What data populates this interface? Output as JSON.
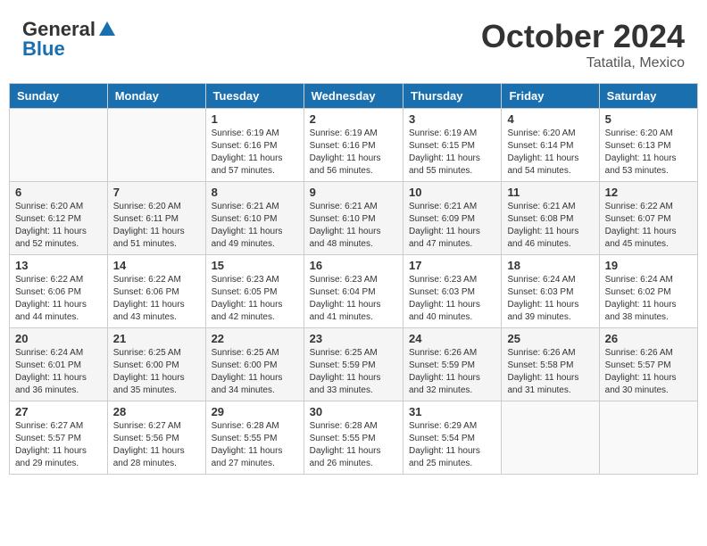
{
  "header": {
    "logo_line1": "General",
    "logo_line2": "Blue",
    "month": "October 2024",
    "location": "Tatatila, Mexico"
  },
  "days_of_week": [
    "Sunday",
    "Monday",
    "Tuesday",
    "Wednesday",
    "Thursday",
    "Friday",
    "Saturday"
  ],
  "weeks": [
    [
      {
        "day": "",
        "sunrise": "",
        "sunset": "",
        "daylight": "",
        "empty": true
      },
      {
        "day": "",
        "sunrise": "",
        "sunset": "",
        "daylight": "",
        "empty": true
      },
      {
        "day": "1",
        "sunrise": "Sunrise: 6:19 AM",
        "sunset": "Sunset: 6:16 PM",
        "daylight": "Daylight: 11 hours and 57 minutes."
      },
      {
        "day": "2",
        "sunrise": "Sunrise: 6:19 AM",
        "sunset": "Sunset: 6:16 PM",
        "daylight": "Daylight: 11 hours and 56 minutes."
      },
      {
        "day": "3",
        "sunrise": "Sunrise: 6:19 AM",
        "sunset": "Sunset: 6:15 PM",
        "daylight": "Daylight: 11 hours and 55 minutes."
      },
      {
        "day": "4",
        "sunrise": "Sunrise: 6:20 AM",
        "sunset": "Sunset: 6:14 PM",
        "daylight": "Daylight: 11 hours and 54 minutes."
      },
      {
        "day": "5",
        "sunrise": "Sunrise: 6:20 AM",
        "sunset": "Sunset: 6:13 PM",
        "daylight": "Daylight: 11 hours and 53 minutes."
      }
    ],
    [
      {
        "day": "6",
        "sunrise": "Sunrise: 6:20 AM",
        "sunset": "Sunset: 6:12 PM",
        "daylight": "Daylight: 11 hours and 52 minutes."
      },
      {
        "day": "7",
        "sunrise": "Sunrise: 6:20 AM",
        "sunset": "Sunset: 6:11 PM",
        "daylight": "Daylight: 11 hours and 51 minutes."
      },
      {
        "day": "8",
        "sunrise": "Sunrise: 6:21 AM",
        "sunset": "Sunset: 6:10 PM",
        "daylight": "Daylight: 11 hours and 49 minutes."
      },
      {
        "day": "9",
        "sunrise": "Sunrise: 6:21 AM",
        "sunset": "Sunset: 6:10 PM",
        "daylight": "Daylight: 11 hours and 48 minutes."
      },
      {
        "day": "10",
        "sunrise": "Sunrise: 6:21 AM",
        "sunset": "Sunset: 6:09 PM",
        "daylight": "Daylight: 11 hours and 47 minutes."
      },
      {
        "day": "11",
        "sunrise": "Sunrise: 6:21 AM",
        "sunset": "Sunset: 6:08 PM",
        "daylight": "Daylight: 11 hours and 46 minutes."
      },
      {
        "day": "12",
        "sunrise": "Sunrise: 6:22 AM",
        "sunset": "Sunset: 6:07 PM",
        "daylight": "Daylight: 11 hours and 45 minutes."
      }
    ],
    [
      {
        "day": "13",
        "sunrise": "Sunrise: 6:22 AM",
        "sunset": "Sunset: 6:06 PM",
        "daylight": "Daylight: 11 hours and 44 minutes."
      },
      {
        "day": "14",
        "sunrise": "Sunrise: 6:22 AM",
        "sunset": "Sunset: 6:06 PM",
        "daylight": "Daylight: 11 hours and 43 minutes."
      },
      {
        "day": "15",
        "sunrise": "Sunrise: 6:23 AM",
        "sunset": "Sunset: 6:05 PM",
        "daylight": "Daylight: 11 hours and 42 minutes."
      },
      {
        "day": "16",
        "sunrise": "Sunrise: 6:23 AM",
        "sunset": "Sunset: 6:04 PM",
        "daylight": "Daylight: 11 hours and 41 minutes."
      },
      {
        "day": "17",
        "sunrise": "Sunrise: 6:23 AM",
        "sunset": "Sunset: 6:03 PM",
        "daylight": "Daylight: 11 hours and 40 minutes."
      },
      {
        "day": "18",
        "sunrise": "Sunrise: 6:24 AM",
        "sunset": "Sunset: 6:03 PM",
        "daylight": "Daylight: 11 hours and 39 minutes."
      },
      {
        "day": "19",
        "sunrise": "Sunrise: 6:24 AM",
        "sunset": "Sunset: 6:02 PM",
        "daylight": "Daylight: 11 hours and 38 minutes."
      }
    ],
    [
      {
        "day": "20",
        "sunrise": "Sunrise: 6:24 AM",
        "sunset": "Sunset: 6:01 PM",
        "daylight": "Daylight: 11 hours and 36 minutes."
      },
      {
        "day": "21",
        "sunrise": "Sunrise: 6:25 AM",
        "sunset": "Sunset: 6:00 PM",
        "daylight": "Daylight: 11 hours and 35 minutes."
      },
      {
        "day": "22",
        "sunrise": "Sunrise: 6:25 AM",
        "sunset": "Sunset: 6:00 PM",
        "daylight": "Daylight: 11 hours and 34 minutes."
      },
      {
        "day": "23",
        "sunrise": "Sunrise: 6:25 AM",
        "sunset": "Sunset: 5:59 PM",
        "daylight": "Daylight: 11 hours and 33 minutes."
      },
      {
        "day": "24",
        "sunrise": "Sunrise: 6:26 AM",
        "sunset": "Sunset: 5:59 PM",
        "daylight": "Daylight: 11 hours and 32 minutes."
      },
      {
        "day": "25",
        "sunrise": "Sunrise: 6:26 AM",
        "sunset": "Sunset: 5:58 PM",
        "daylight": "Daylight: 11 hours and 31 minutes."
      },
      {
        "day": "26",
        "sunrise": "Sunrise: 6:26 AM",
        "sunset": "Sunset: 5:57 PM",
        "daylight": "Daylight: 11 hours and 30 minutes."
      }
    ],
    [
      {
        "day": "27",
        "sunrise": "Sunrise: 6:27 AM",
        "sunset": "Sunset: 5:57 PM",
        "daylight": "Daylight: 11 hours and 29 minutes."
      },
      {
        "day": "28",
        "sunrise": "Sunrise: 6:27 AM",
        "sunset": "Sunset: 5:56 PM",
        "daylight": "Daylight: 11 hours and 28 minutes."
      },
      {
        "day": "29",
        "sunrise": "Sunrise: 6:28 AM",
        "sunset": "Sunset: 5:55 PM",
        "daylight": "Daylight: 11 hours and 27 minutes."
      },
      {
        "day": "30",
        "sunrise": "Sunrise: 6:28 AM",
        "sunset": "Sunset: 5:55 PM",
        "daylight": "Daylight: 11 hours and 26 minutes."
      },
      {
        "day": "31",
        "sunrise": "Sunrise: 6:29 AM",
        "sunset": "Sunset: 5:54 PM",
        "daylight": "Daylight: 11 hours and 25 minutes."
      },
      {
        "day": "",
        "sunrise": "",
        "sunset": "",
        "daylight": "",
        "empty": true
      },
      {
        "day": "",
        "sunrise": "",
        "sunset": "",
        "daylight": "",
        "empty": true
      }
    ]
  ]
}
